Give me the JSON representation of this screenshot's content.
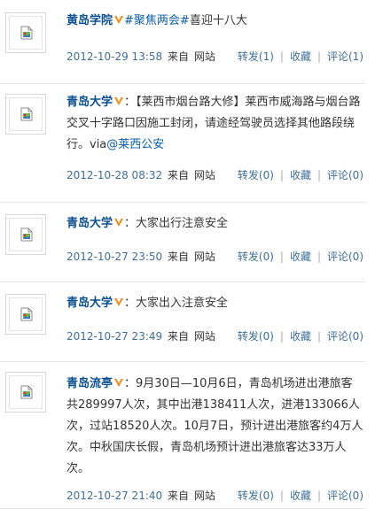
{
  "posts": [
    {
      "user": "黄岛学院",
      "vip": true,
      "text": "#聚焦两会#喜迎十八大",
      "topic": "#聚焦两会#",
      "rest": "喜迎十八大",
      "time": "2012-10-29 13:58",
      "source_prefix": "来自",
      "source": "网站",
      "repost": "转发(1)",
      "collect": "收藏",
      "comment": "评论(1)"
    },
    {
      "user": "青岛大学",
      "vip": true,
      "sep": "：",
      "text": "【莱西市烟台路大修】莱西市威海路与烟台路交叉十字路口因施工封闭，请途经驾驶员选择其他路段绕行。via",
      "mention": "@莱西公安",
      "time": "2012-10-28 08:32",
      "source_prefix": "来自",
      "source": "网站",
      "repost": "转发(0)",
      "collect": "收藏",
      "comment": "评论(0)"
    },
    {
      "user": "青岛大学",
      "vip": true,
      "sep": "：",
      "text": "大家出行注意安全",
      "time": "2012-10-27 23:50",
      "source_prefix": "来自",
      "source": "网站",
      "repost": "转发(0)",
      "collect": "收藏",
      "comment": "评论(0)"
    },
    {
      "user": "青岛大学",
      "vip": true,
      "sep": "：",
      "text": "大家出入注意安全",
      "time": "2012-10-27 23:49",
      "source_prefix": "来自",
      "source": "网站",
      "repost": "转发(0)",
      "collect": "收藏",
      "comment": "评论(0)"
    },
    {
      "user": "青岛流亭",
      "vip": true,
      "sep": "：",
      "text": "9月30日—10月6日，青岛机场进出港旅客共289997人次，其中出港138411人次，进港133066人次，过站18520人次。10月7日，预计进出港旅客约4万人次。中秋国庆长假，青岛机场预计进出港旅客达33万人次。",
      "time": "2012-10-27 21:40",
      "source_prefix": "来自",
      "source": "网站",
      "repost": "转发(0)",
      "collect": "收藏",
      "comment": "评论(0)"
    }
  ],
  "colors": {
    "username": "#0a4f8f",
    "meta": "#3e6e9a",
    "text": "#333333",
    "vip": "#f28c1a"
  },
  "icons": {
    "avatar": "broken-image-icon",
    "vip": "vip-v-icon"
  }
}
